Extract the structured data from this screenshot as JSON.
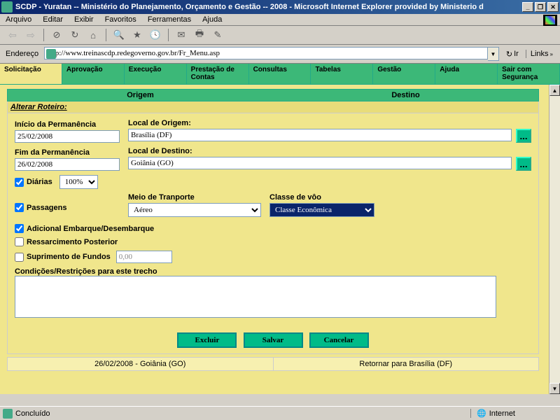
{
  "window": {
    "title": "SCDP - Yuratan -- Ministério do Planejamento, Orçamento e Gestão -- 2008 - Microsoft Internet Explorer provided by Ministerio d"
  },
  "menus": [
    "Arquivo",
    "Editar",
    "Exibir",
    "Favoritos",
    "Ferramentas",
    "Ajuda"
  ],
  "address": {
    "label": "Endereço",
    "url": "http://www.treinascdp.redegoverno.gov.br/Fr_Menu.asp",
    "go": "Ir",
    "links": "Links"
  },
  "tabs": [
    "Solicitação",
    "Aprovação",
    "Execução",
    "Prestação de Contas",
    "Consultas",
    "Tabelas",
    "Gestão",
    "Ajuda",
    "Sair com Segurança"
  ],
  "od": {
    "origem": "Origem",
    "destino": "Destino"
  },
  "section": "Alterar Roteiro:",
  "fields": {
    "inicio_label": "Início da Permanência",
    "inicio_value": "25/02/2008",
    "fim_label": "Fim da Permanência",
    "fim_value": "26/02/2008",
    "origem_label": "Local de Origem:",
    "origem_value": "Brasília (DF)",
    "destino_label": "Local de Destino:",
    "destino_value": "Goiânia (GO)",
    "diarias_label": "Diárias",
    "diarias_pct": "100%",
    "passagens_label": "Passagens",
    "meio_label": "Meio de Tranporte",
    "meio_value": "Aéreo",
    "classe_label": "Classe de vôo",
    "classe_value": "Classe Econômica",
    "adicional": "Adicional Embarque/Desembarque",
    "ressarc": "Ressarcimento Posterior",
    "suprimento": "Suprimento de Fundos",
    "suprimento_value": "0,00",
    "condicoes": "Condições/Restrições para este trecho"
  },
  "buttons": {
    "excluir": "Excluir",
    "salvar": "Salvar",
    "cancelar": "Cancelar",
    "lookup": "..."
  },
  "footer": {
    "left": "26/02/2008 - Goiânia (GO)",
    "right": "Retornar para Brasília (DF)"
  },
  "status": {
    "done": "Concluído",
    "zone": "Internet"
  }
}
